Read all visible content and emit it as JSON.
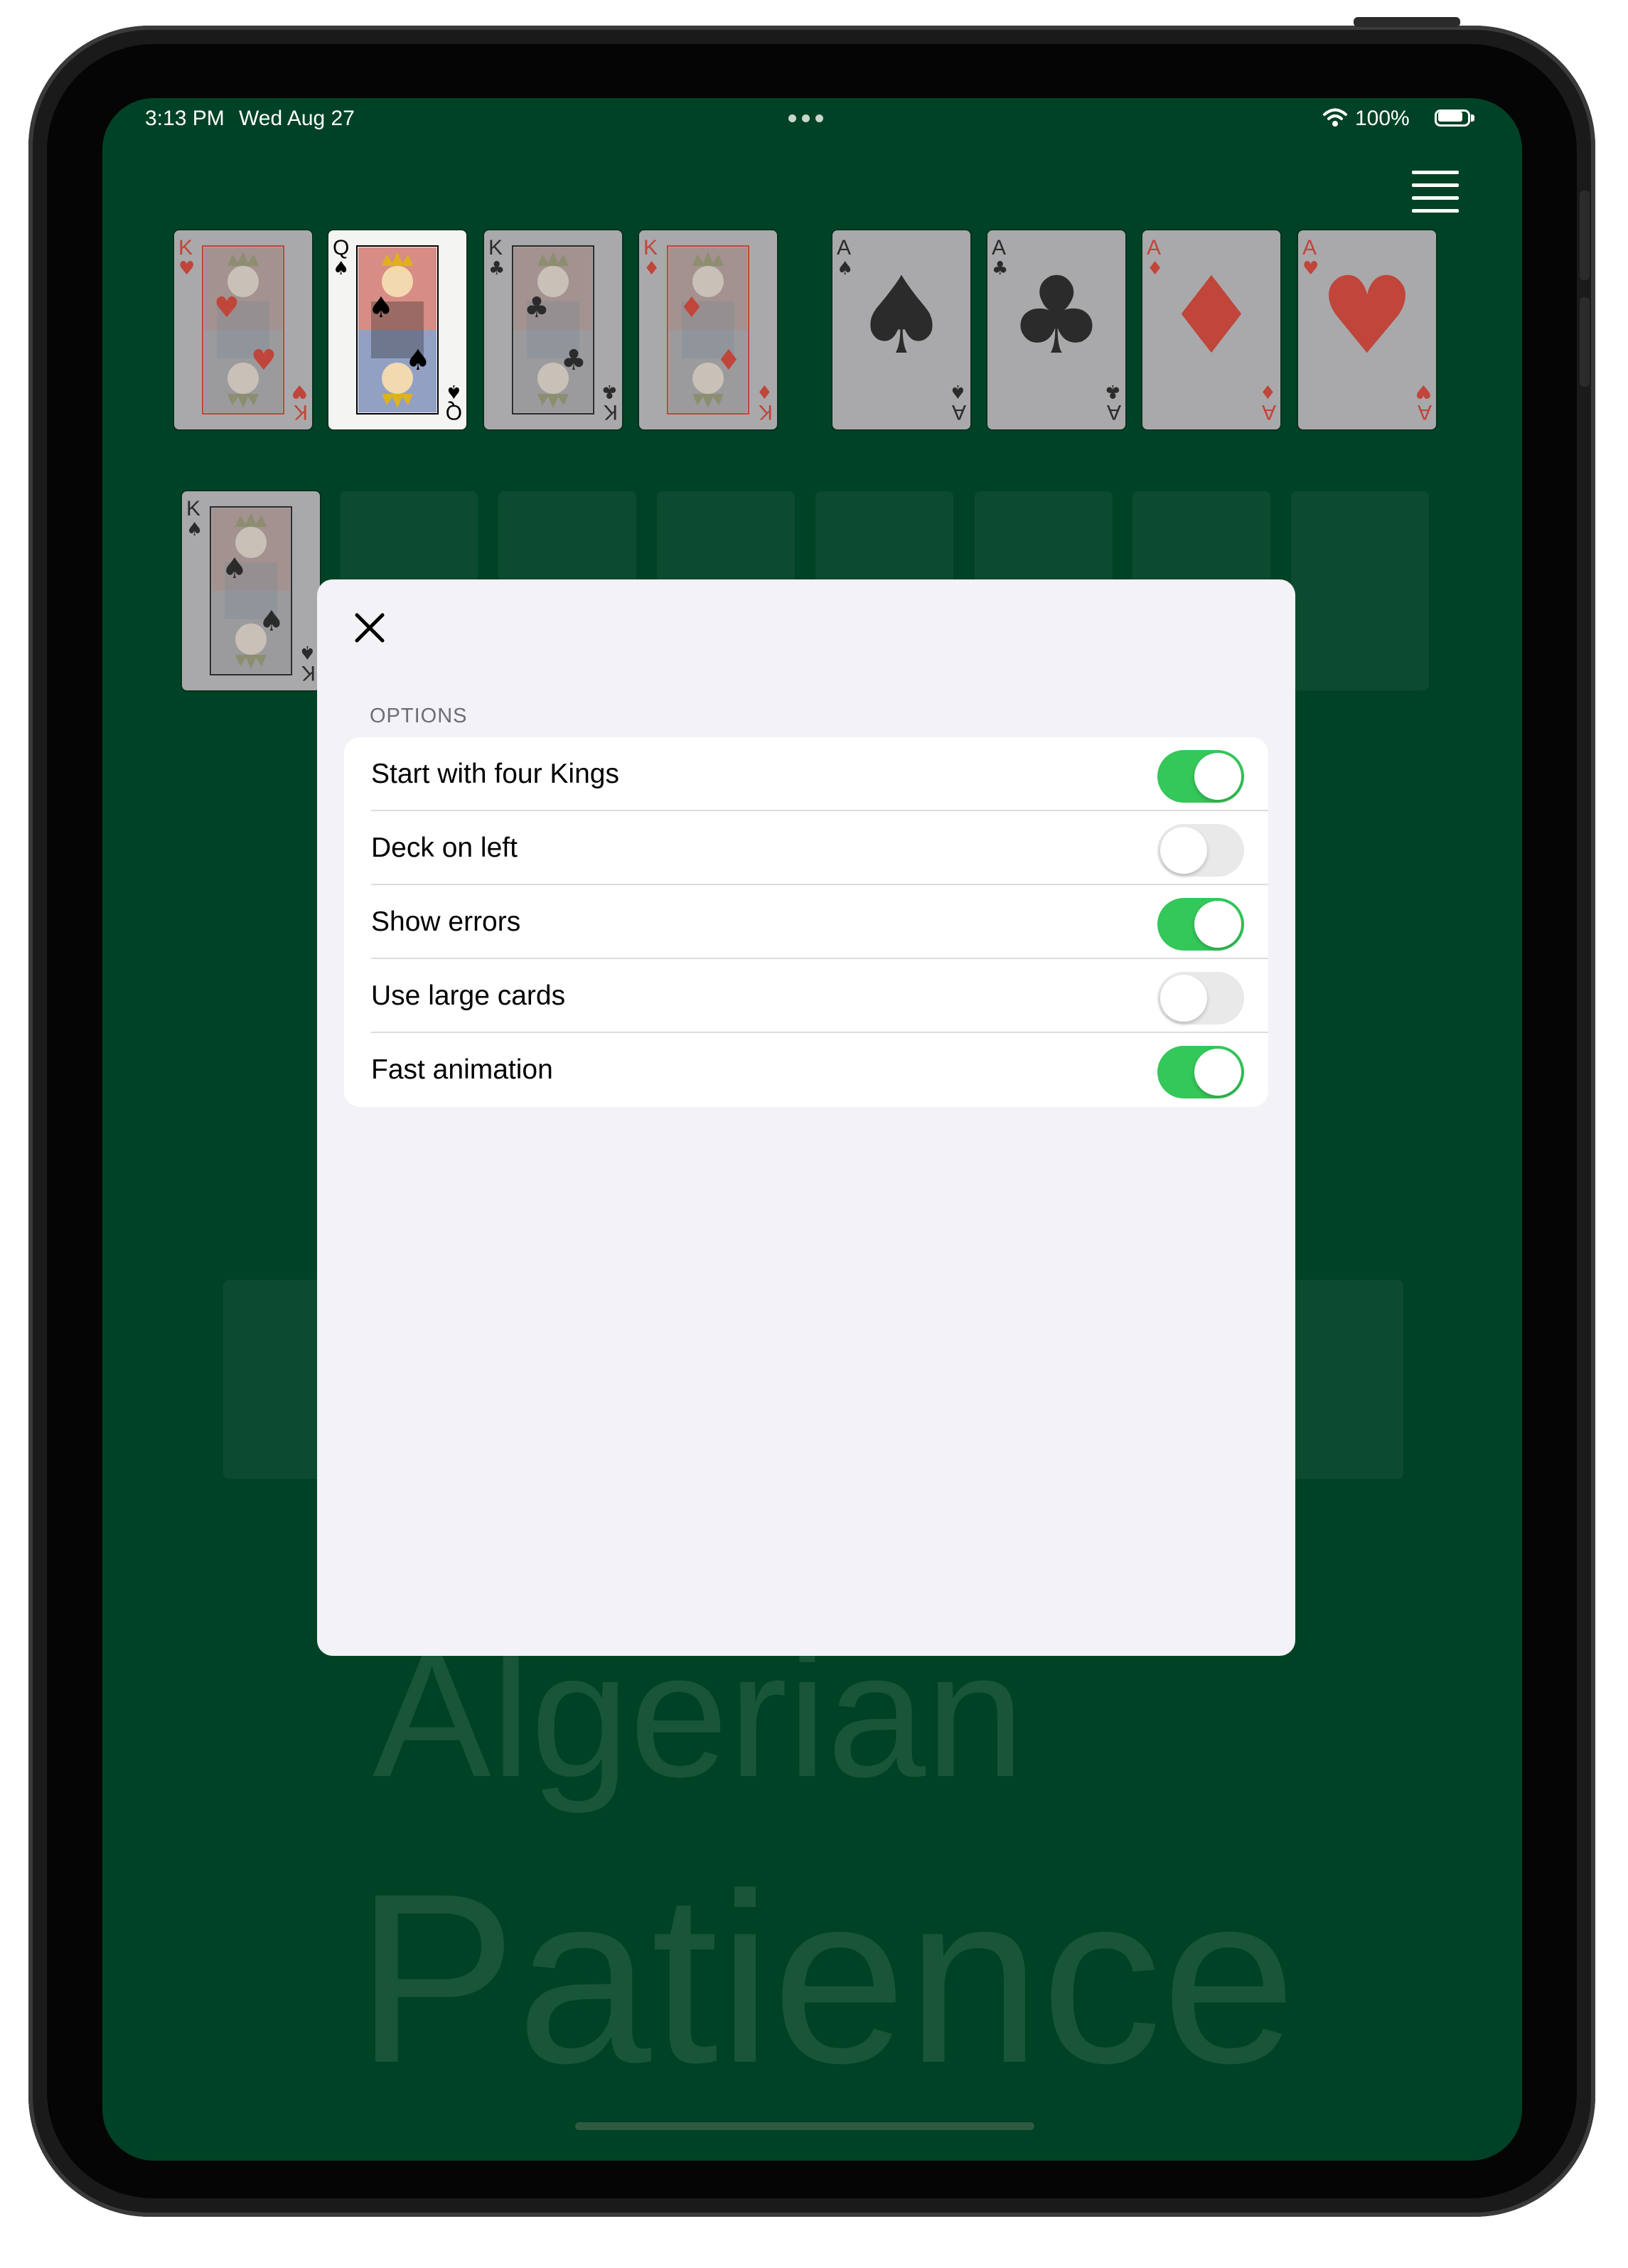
{
  "status_bar": {
    "time": "3:13 PM",
    "date": "Wed Aug 27",
    "battery": "100%",
    "battery_level": 1.0,
    "wifi_icon": "wifi-icon",
    "battery_icon": "battery-icon"
  },
  "menu": {
    "icon": "hamburger-menu-icon"
  },
  "top_row_cards": [
    {
      "rank": "K",
      "suit": "♥",
      "color": "#c0392b"
    },
    {
      "rank": "Q",
      "suit": "♠",
      "color": "#000000"
    },
    {
      "rank": "K",
      "suit": "♣",
      "color": "#000000"
    },
    {
      "rank": "K",
      "suit": "♦",
      "color": "#c0392b"
    }
  ],
  "foundation_cards": [
    {
      "rank": "A",
      "suit": "♠",
      "color": "#000000"
    },
    {
      "rank": "A",
      "suit": "♣",
      "color": "#000000"
    },
    {
      "rank": "A",
      "suit": "♦",
      "color": "#c0392b"
    },
    {
      "rank": "A",
      "suit": "♥",
      "color": "#c0392b"
    }
  ],
  "tableau_card": {
    "rank": "K",
    "suit": "♠",
    "color": "#000000"
  },
  "background_title": {
    "line1": "Algerian",
    "line2": "Patience"
  },
  "options_modal": {
    "close_icon": "close-icon",
    "header": "OPTIONS",
    "rows": [
      {
        "label": "Start with four Kings",
        "on": true
      },
      {
        "label": "Deck on left",
        "on": false
      },
      {
        "label": "Show errors",
        "on": true
      },
      {
        "label": "Use large cards",
        "on": false
      },
      {
        "label": "Fast animation",
        "on": true
      }
    ]
  },
  "colors": {
    "felt": "#004225",
    "toggle_on": "#34c759",
    "toggle_off": "#e9e9ea",
    "modal_bg": "#f2f2f7"
  }
}
